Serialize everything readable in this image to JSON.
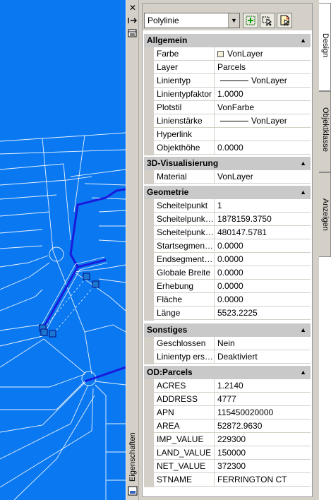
{
  "palette": {
    "caption": "Eigenschaften",
    "object_type": "Polylinie",
    "tabs": [
      "Design",
      "Objektklasse",
      "Anzeigen"
    ]
  },
  "sections": {
    "allgemein": {
      "title": "Allgemein",
      "rows": [
        {
          "name": "Farbe",
          "value": "VonLayer"
        },
        {
          "name": "Layer",
          "value": "Parcels"
        },
        {
          "name": "Linientyp",
          "value": "VonLayer"
        },
        {
          "name": "Linientypfaktor",
          "value": "1.0000"
        },
        {
          "name": "Plotstil",
          "value": "VonFarbe"
        },
        {
          "name": "Linienstärke",
          "value": "VonLayer"
        },
        {
          "name": "Hyperlink",
          "value": ""
        },
        {
          "name": "Objekthöhe",
          "value": "0.0000"
        }
      ]
    },
    "visualisierung": {
      "title": "3D-Visualisierung",
      "rows": [
        {
          "name": "Material",
          "value": "VonLayer"
        }
      ]
    },
    "geometrie": {
      "title": "Geometrie",
      "rows": [
        {
          "name": "Scheitelpunkt",
          "value": "1"
        },
        {
          "name": "Scheitelpunkt X",
          "value": "1878159.3750"
        },
        {
          "name": "Scheitelpunkt Y",
          "value": "480147.5781"
        },
        {
          "name": "Startsegment...",
          "value": "0.0000"
        },
        {
          "name": "Endsegmentb...",
          "value": "0.0000"
        },
        {
          "name": "Globale Breite",
          "value": "0.0000"
        },
        {
          "name": "Erhebung",
          "value": "0.0000"
        },
        {
          "name": "Fläche",
          "value": "0.0000"
        },
        {
          "name": "Länge",
          "value": "5523.2225"
        }
      ]
    },
    "sonstiges": {
      "title": "Sonstiges",
      "rows": [
        {
          "name": "Geschlossen",
          "value": "Nein"
        },
        {
          "name": "Linientyp erst...",
          "value": "Deaktiviert"
        }
      ]
    },
    "odparcels": {
      "title": "OD:Parcels",
      "rows": [
        {
          "name": "ACRES",
          "value": "1.2140"
        },
        {
          "name": "ADDRESS",
          "value": "4777"
        },
        {
          "name": "APN",
          "value": "115450020000"
        },
        {
          "name": "AREA",
          "value": "52872.9630"
        },
        {
          "name": "IMP_VALUE",
          "value": "229300"
        },
        {
          "name": "LAND_VALUE",
          "value": "150000"
        },
        {
          "name": "NET_VALUE",
          "value": "372300"
        },
        {
          "name": "STNAME",
          "value": "FERRINGTON CT"
        }
      ]
    }
  },
  "colors": {
    "drawing_background": "#0a78f0",
    "parcel_lines": "#e8f2ff",
    "road_lines": "#1a1adc"
  }
}
